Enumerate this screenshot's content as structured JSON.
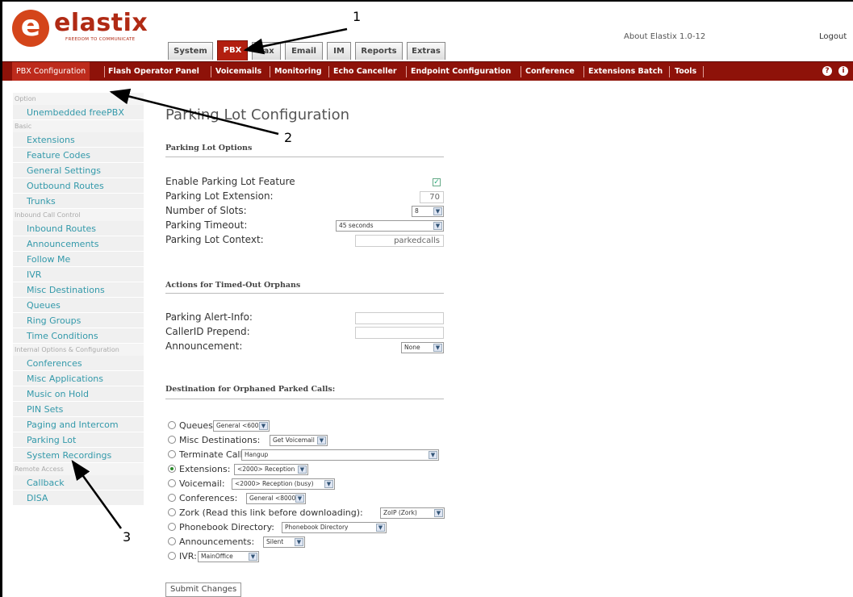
{
  "header": {
    "logo_text": "elastix",
    "logo_tagline": "FREEDOM TO COMMUNICATE",
    "about": "About Elastix 1.0-12",
    "logout": "Logout"
  },
  "main_tabs": [
    "System",
    "PBX",
    "Fax",
    "Email",
    "IM",
    "Reports",
    "Extras"
  ],
  "subnav": [
    "PBX Configuration",
    "Flash Operator Panel",
    "Voicemails",
    "Monitoring",
    "Echo Canceller",
    "Endpoint Configuration",
    "Conference",
    "Extensions Batch",
    "Tools"
  ],
  "sidebar": {
    "option": "Option",
    "unembedded": "Unembedded freePBX",
    "basic": "Basic",
    "extensions": "Extensions",
    "feature_codes": "Feature Codes",
    "general_settings": "General Settings",
    "outbound_routes": "Outbound Routes",
    "trunks": "Trunks",
    "inbound_call_control": "Inbound Call Control",
    "inbound_routes": "Inbound Routes",
    "announcements": "Announcements",
    "follow_me": "Follow Me",
    "ivr": "IVR",
    "misc_destinations": "Misc Destinations",
    "queues": "Queues",
    "ring_groups": "Ring Groups",
    "time_conditions": "Time Conditions",
    "internal_options": "Internal Options & Configuration",
    "conferences": "Conferences",
    "misc_applications": "Misc Applications",
    "music_on_hold": "Music on Hold",
    "pin_sets": "PIN Sets",
    "paging_intercom": "Paging and Intercom",
    "parking_lot": "Parking Lot",
    "system_recordings": "System Recordings",
    "remote_access": "Remote Access",
    "callback": "Callback",
    "disa": "DISA"
  },
  "page": {
    "title": "Parking Lot Configuration",
    "options_heading": "Parking Lot Options",
    "enable_label": "Enable Parking Lot Feature",
    "enable_checked": true,
    "extension_label": "Parking Lot Extension:",
    "extension_value": "70",
    "slots_label": "Number of Slots:",
    "slots_value": "8",
    "timeout_label": "Parking Timeout:",
    "timeout_value": "45 seconds",
    "context_label": "Parking Lot Context:",
    "context_value": "parkedcalls",
    "orphans_heading": "Actions for Timed-Out Orphans",
    "alert_label": "Parking Alert-Info:",
    "alert_value": "",
    "callerid_label": "CallerID Prepend:",
    "callerid_value": "",
    "announcement_label": "Announcement:",
    "announcement_value": "None",
    "destination_heading": "Destination for Orphaned Parked Calls:",
    "submit": "Submit Changes"
  },
  "destinations": {
    "queues_label": "Queues:",
    "queues_value": "General <600>",
    "misc_label": "Misc Destinations:",
    "misc_value": "Get Voicemail",
    "terminate_label": "Terminate Call:",
    "terminate_value": "Hangup",
    "extensions_label": "Extensions:",
    "extensions_value": "<2000> Reception",
    "voicemail_label": "Voicemail:",
    "voicemail_value": "<2000> Reception (busy)",
    "conferences_label": "Conferences:",
    "conferences_value": "General <8000>",
    "zork_label": "Zork (Read this link before downloading):",
    "zork_value": "ZoIP (Zork)",
    "phonebook_label": "Phonebook Directory:",
    "phonebook_value": "Phonebook Directory",
    "announcements_label": "Announcements:",
    "announcements_value": "Silent",
    "ivr_label": "IVR:",
    "ivr_value": "MainOffice",
    "selected": "Extensions"
  },
  "annotations": [
    "1",
    "2",
    "3"
  ]
}
